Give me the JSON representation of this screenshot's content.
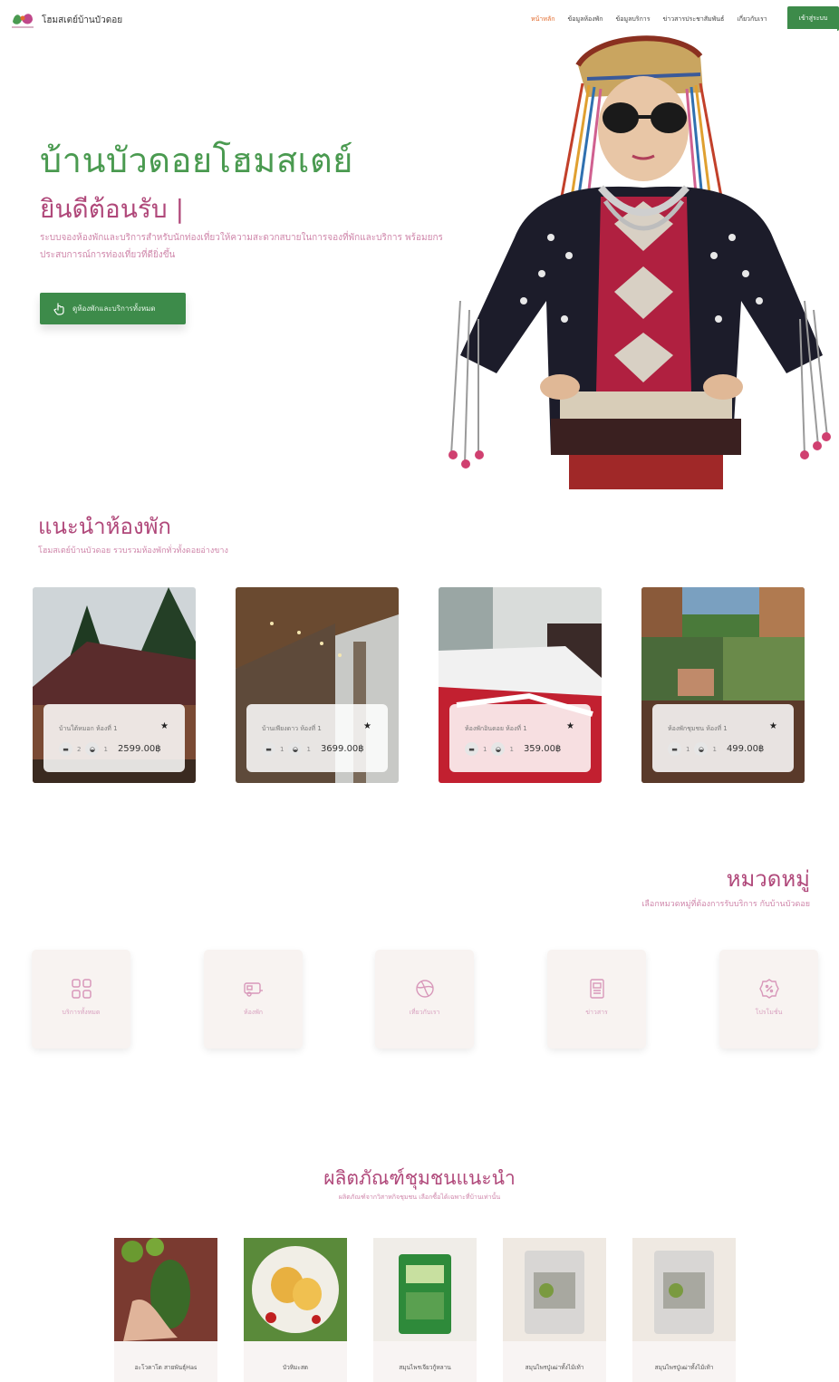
{
  "nav": {
    "brand": "โฮมสเตย์บ้านบัวดอย",
    "links": [
      "หน้าหลัก",
      "ข้อมูลห้องพัก",
      "ข้อมูลบริการ",
      "ข่าวสารประชาสัมพันธ์",
      "เกี่ยวกับเรา"
    ],
    "login": "เข้าสู่ระบบ"
  },
  "hero": {
    "title": "บ้านบัวดอยโฮมสเตย์",
    "subtitle": "ยินดีต้อนรับ |",
    "description": "ระบบจองห้องพักและบริการสำหรับนักท่องเที่ยวให้ความสะดวกสบายในการจองที่พักและบริการ พร้อมยกระดับประสบการณ์การท่องเที่ยวที่ดียิ่งขึ้น",
    "button": "ดูห้องพักและบริการทั้งหมด"
  },
  "rooms": {
    "title": "แนะนำห้องพัก",
    "subtitle": "โฮมสเตย์บ้านบัวดอย รวบรวมห้องพักทั่วทั้งดอยอ่างขาง",
    "items": [
      {
        "name": "บ้านใต้หมอก ห้องที่ 1",
        "beds": "2",
        "baths": "1",
        "price": "2599.00฿"
      },
      {
        "name": "บ้านเพียงดาว ห้องที่ 1",
        "beds": "1",
        "baths": "1",
        "price": "3699.00฿"
      },
      {
        "name": "ห้องพักอินดอย ห้องที่ 1",
        "beds": "1",
        "baths": "1",
        "price": "359.00฿"
      },
      {
        "name": "ห้องพักชุมชน ห้องที่ 1",
        "beds": "1",
        "baths": "1",
        "price": "499.00฿"
      }
    ]
  },
  "categories": {
    "title": "หมวดหมู่",
    "subtitle": "เลือกหมวดหมู่ที่ต้องการรับบริการ กับบ้านบัวดอย",
    "items": [
      {
        "label": "บริการทั้งหมด",
        "icon": "grid-icon"
      },
      {
        "label": "ห้องพัก",
        "icon": "camper-icon"
      },
      {
        "label": "เที่ยวกับเรา",
        "icon": "globe-icon"
      },
      {
        "label": "ข่าวสาร",
        "icon": "news-icon"
      },
      {
        "label": "โปรโมชั่น",
        "icon": "discount-icon"
      }
    ]
  },
  "products": {
    "title": "ผลิตภัณฑ์ชุมชนแนะนำ",
    "subtitle": "ผลิตภัณฑ์จากวิสาหกิจชุมชน เลือกซื้อได้เฉพาะที่บ้านเท่านั้น",
    "items": [
      {
        "label": "อะโวคาโด สายพันธุ์Has"
      },
      {
        "label": "บัวหิมะสด"
      },
      {
        "label": "สมุนไพรเจียวกู้หลาน"
      },
      {
        "label": "สมุนไพรปู่เฒ่าทั้งไม้เท้า"
      },
      {
        "label": "สมุนไพรปู่เฒ่าทั้งไม้เท้า"
      }
    ]
  },
  "colors": {
    "green": "#3d8b4a",
    "pink": "#b0487a",
    "orange": "#e26a2c"
  }
}
